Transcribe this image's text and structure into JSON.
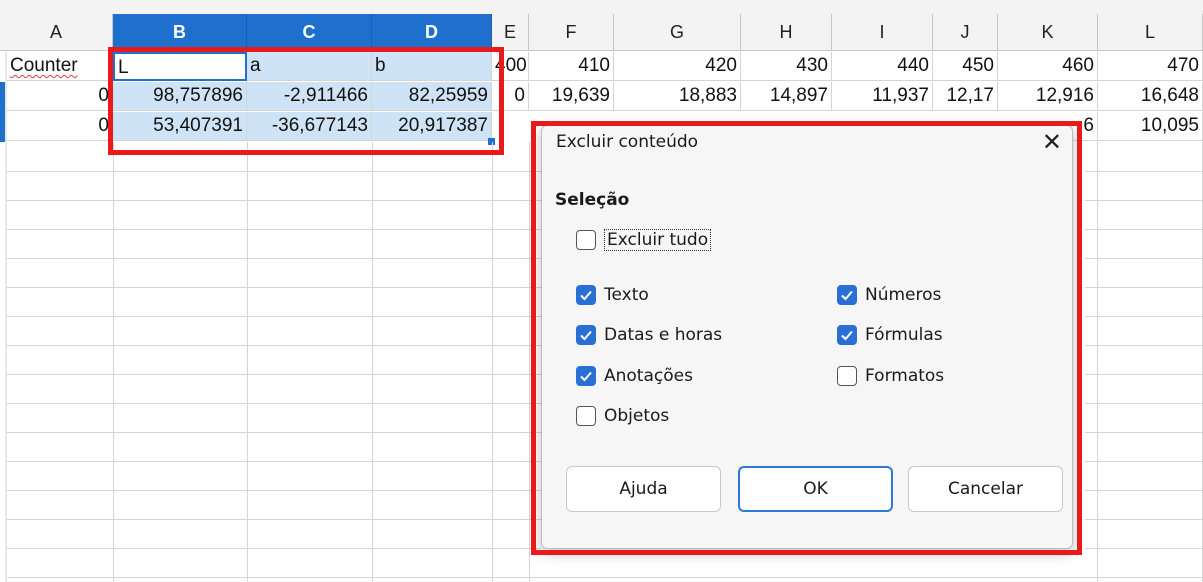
{
  "spreadsheet": {
    "columns": [
      "A",
      "B",
      "C",
      "D",
      "E",
      "F",
      "G",
      "H",
      "I",
      "J",
      "K",
      "L"
    ],
    "selected_columns": [
      "B",
      "C",
      "D"
    ],
    "rows": [
      [
        "Counter",
        "L",
        "a",
        "b",
        "400",
        "410",
        "420",
        "430",
        "440",
        "450",
        "460",
        "470"
      ],
      [
        "0",
        "98,757896",
        "-2,911466",
        "82,25959",
        "0",
        "19,639",
        "18,883",
        "14,897",
        "11,937",
        "12,17",
        "12,916",
        "16,648"
      ],
      [
        "0",
        "53,407391",
        "-36,677143",
        "20,917387",
        "",
        "",
        "",
        "",
        "",
        "",
        "6",
        "10,095"
      ]
    ]
  },
  "dialog": {
    "title": "Excluir conteúdo",
    "section_label": "Seleção",
    "delete_all": {
      "label": "Excluir tudo",
      "checked": false
    },
    "options": {
      "text": {
        "label": "Texto",
        "checked": true
      },
      "numbers": {
        "label": "Números",
        "checked": true
      },
      "dates_times": {
        "label": "Datas e horas",
        "checked": true
      },
      "formulas": {
        "label": "Fórmulas",
        "checked": true
      },
      "comments": {
        "label": "Anotações",
        "checked": true
      },
      "formats": {
        "label": "Formatos",
        "checked": false
      },
      "objects": {
        "label": "Objetos",
        "checked": false
      }
    },
    "buttons": {
      "help": "Ajuda",
      "ok": "OK",
      "cancel": "Cancelar"
    },
    "close_icon": "close-icon"
  },
  "colors": {
    "selection_header": "#1e6fce",
    "selection_fill": "#cfe3f7",
    "checkbox_on": "#2a6fd4",
    "highlight_box": "#e81a1a"
  }
}
